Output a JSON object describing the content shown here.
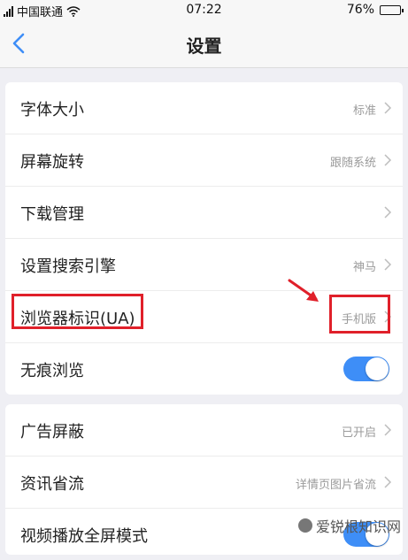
{
  "statusbar": {
    "carrier": "中国联通",
    "time": "07:22",
    "battery": "76%",
    "battery_level": 0.76
  },
  "header": {
    "title": "设置"
  },
  "group1": [
    {
      "label": "字体大小",
      "value": "标准",
      "control": "chevron"
    },
    {
      "label": "屏幕旋转",
      "value": "跟随系统",
      "control": "chevron"
    },
    {
      "label": "下载管理",
      "value": "",
      "control": "chevron"
    },
    {
      "label": "设置搜索引擎",
      "value": "神马",
      "control": "chevron"
    },
    {
      "label": "浏览器标识(UA)",
      "value": "手机版",
      "control": "chevron"
    },
    {
      "label": "无痕浏览",
      "value": "",
      "control": "toggle",
      "on": true
    }
  ],
  "group2": [
    {
      "label": "广告屏蔽",
      "value": "已开启",
      "control": "chevron"
    },
    {
      "label": "资讯省流",
      "value": "详情页图片省流",
      "control": "chevron"
    },
    {
      "label": "视频播放全屏模式",
      "value": "",
      "control": "toggle",
      "on": true
    }
  ],
  "watermark": {
    "text": "爱锐根知识网"
  },
  "colors": {
    "accent": "#3e8ef7",
    "highlight": "#e0202a",
    "background": "#efeff4"
  }
}
